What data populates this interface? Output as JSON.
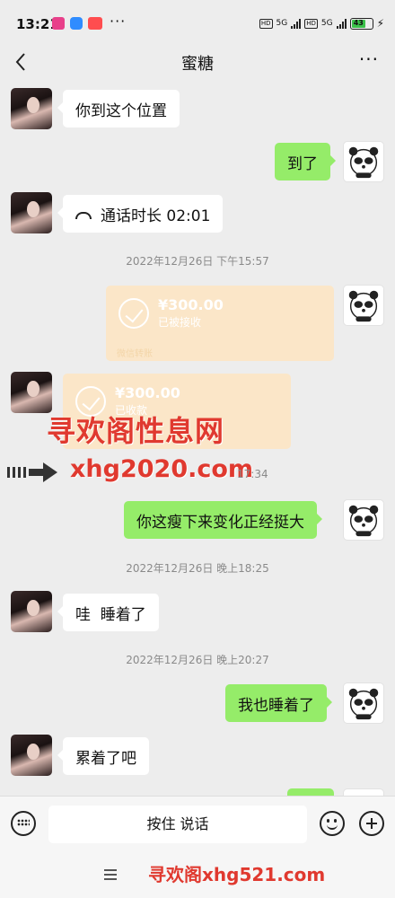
{
  "status_bar": {
    "time": "13:21",
    "network_label_1": "5G",
    "network_label_2": "5G",
    "hd_label": "HD",
    "battery_level": "43"
  },
  "header": {
    "title": "蜜糖",
    "more_label": "···"
  },
  "messages": [
    {
      "side": "in",
      "text": "你到这个位置"
    },
    {
      "side": "out",
      "text": "到了"
    },
    {
      "side": "in",
      "type": "call",
      "text": "通话时长 02:01"
    },
    {
      "type": "timestamp",
      "text": "2022年12月26日 下午15:57"
    },
    {
      "side": "out",
      "type": "transfer",
      "amount": "¥300.00",
      "status": "已被接收",
      "footer": "微信转账"
    },
    {
      "side": "in",
      "type": "transfer",
      "amount": "¥300.00",
      "status": "已收款"
    },
    {
      "type": "timestamp",
      "text": "17:34"
    },
    {
      "side": "out",
      "text": "你这瘦下来变化正经挺大"
    },
    {
      "type": "timestamp",
      "text": "2022年12月26日 晚上18:25"
    },
    {
      "side": "in",
      "text": "哇  睡着了"
    },
    {
      "type": "timestamp",
      "text": "2022年12月26日 晚上20:27"
    },
    {
      "side": "out",
      "text": "我也睡着了"
    },
    {
      "side": "in",
      "text": "累着了吧"
    }
  ],
  "watermarks": {
    "site_name": "寻欢阁性息网",
    "site_url": "xhg2020.com",
    "bottom": "寻欢阁xhg521.com"
  },
  "input_bar": {
    "hold_to_talk": "按住 说话"
  },
  "colors": {
    "outgoing_bubble": "#95ec69",
    "incoming_bubble": "#ffffff",
    "transfer_card": "#fbe6c8",
    "watermark": "#e0392f"
  }
}
